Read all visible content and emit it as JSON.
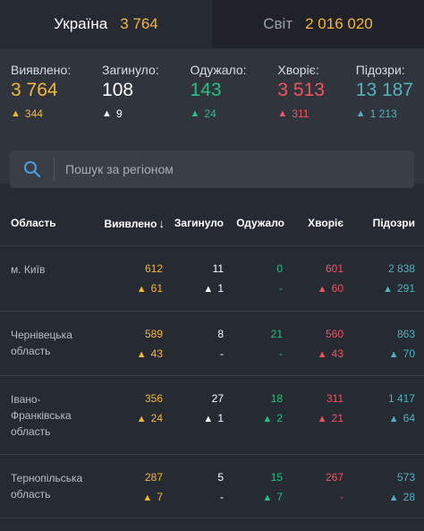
{
  "tabs": {
    "ukraine": {
      "label": "Україна",
      "value": "3 764"
    },
    "world": {
      "label": "Світ",
      "value": "2 016 020"
    }
  },
  "summary": [
    {
      "label": "Виявлено:",
      "value": "3 764",
      "delta": "344",
      "color": "#f7b731"
    },
    {
      "label": "Загинуло:",
      "value": "108",
      "delta": "9",
      "color": "#ffffff"
    },
    {
      "label": "Одужало:",
      "value": "143",
      "delta": "24",
      "color": "#26c281"
    },
    {
      "label": "Хворіє:",
      "value": "3 513",
      "delta": "311",
      "color": "#f2545b"
    },
    {
      "label": "Підозри:",
      "value": "13 187",
      "delta": "1 213",
      "color": "#4fb3bf"
    }
  ],
  "search": {
    "placeholder": "Пошук за регіоном"
  },
  "table": {
    "headers": {
      "region": "Область",
      "detected": "Виявлено",
      "dead": "Загинуло",
      "recovered": "Одужало",
      "sick": "Хворіє",
      "suspected": "Підозри"
    },
    "rows": [
      {
        "region": "м. Київ",
        "detected": "612",
        "detected_d": "61",
        "dead": "11",
        "dead_d": "1",
        "recovered": "0",
        "recovered_d": "-",
        "sick": "601",
        "sick_d": "60",
        "suspected": "2 838",
        "suspected_d": "291"
      },
      {
        "region": "Чернівецька область",
        "detected": "589",
        "detected_d": "43",
        "dead": "8",
        "dead_d": "-",
        "recovered": "21",
        "recovered_d": "-",
        "sick": "560",
        "sick_d": "43",
        "suspected": "863",
        "suspected_d": "70"
      },
      {
        "region": "Івано-Франківська область",
        "detected": "356",
        "detected_d": "24",
        "dead": "27",
        "dead_d": "1",
        "recovered": "18",
        "recovered_d": "2",
        "sick": "311",
        "sick_d": "21",
        "suspected": "1 417",
        "suspected_d": "64"
      },
      {
        "region": "Тернопільська область",
        "detected": "287",
        "detected_d": "7",
        "dead": "5",
        "dead_d": "-",
        "recovered": "15",
        "recovered_d": "7",
        "sick": "267",
        "sick_d": "-",
        "suspected": "573",
        "suspected_d": "28"
      }
    ]
  }
}
